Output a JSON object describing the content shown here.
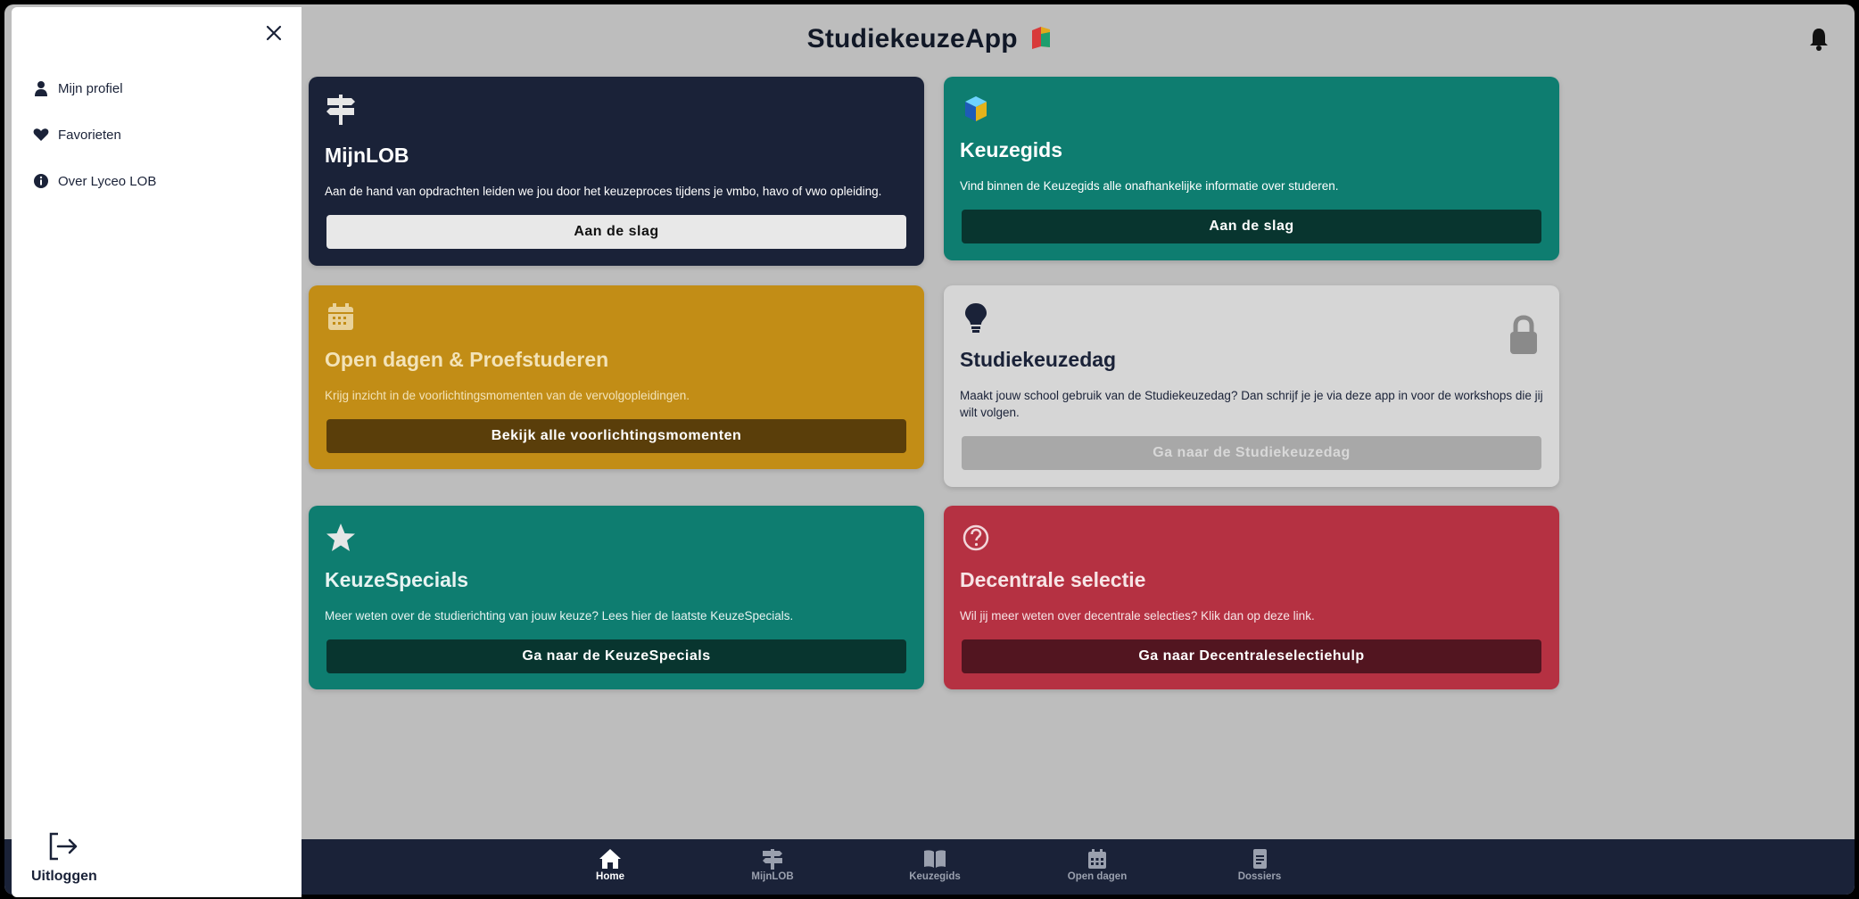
{
  "header": {
    "title": "StudiekeuzeApp"
  },
  "cards": [
    {
      "title": "MijnLOB",
      "description": "Aan de hand van opdrachten leiden we jou door het keuzeproces tijdens je vmbo, havo of vwo opleiding.",
      "button": "Aan de slag"
    },
    {
      "title": "Keuzegids",
      "description": "Vind binnen de Keuzegids alle onafhankelijke informatie over studeren.",
      "button": "Aan de slag"
    },
    {
      "title": "Open dagen & Proefstuderen",
      "description": "Krijg inzicht in de voorlichtingsmomenten van de vervolgopleidingen.",
      "button": "Bekijk alle voorlichtingsmomenten"
    },
    {
      "title": "Studiekeuzedag",
      "description": "Maakt jouw school gebruik van de Studiekeuzedag? Dan schrijf je je via deze app in voor de workshops die jij wilt volgen.",
      "button": "Ga naar de Studiekeuzedag"
    },
    {
      "title": "KeuzeSpecials",
      "description": "Meer weten over de studierichting van jouw keuze? Lees hier de laatste KeuzeSpecials.",
      "button": "Ga naar de KeuzeSpecials"
    },
    {
      "title": "Decentrale selectie",
      "description": "Wil jij meer weten over decentrale selecties? Klik dan op deze link.",
      "button": "Ga naar Decentraleselectiehulp"
    }
  ],
  "bottom_nav": [
    {
      "label": "Home",
      "icon": "home-icon",
      "active": true
    },
    {
      "label": "MijnLOB",
      "icon": "signpost-icon"
    },
    {
      "label": "Keuzegids",
      "icon": "book-icon"
    },
    {
      "label": "Open dagen",
      "icon": "calendar-icon"
    },
    {
      "label": "Dossiers",
      "icon": "document-icon"
    }
  ],
  "side_menu": {
    "items": [
      {
        "label": "Mijn profiel",
        "icon": "user-icon"
      },
      {
        "label": "Favorieten",
        "icon": "heart-icon"
      },
      {
        "label": "Over Lyceo LOB",
        "icon": "info-icon"
      }
    ],
    "logout_label": "Uitloggen"
  },
  "colors": {
    "navy": "#1a2238",
    "teal": "#0e7d70",
    "gold": "#c28d16",
    "red": "#b53142",
    "disabled": "#d6d6d6"
  }
}
